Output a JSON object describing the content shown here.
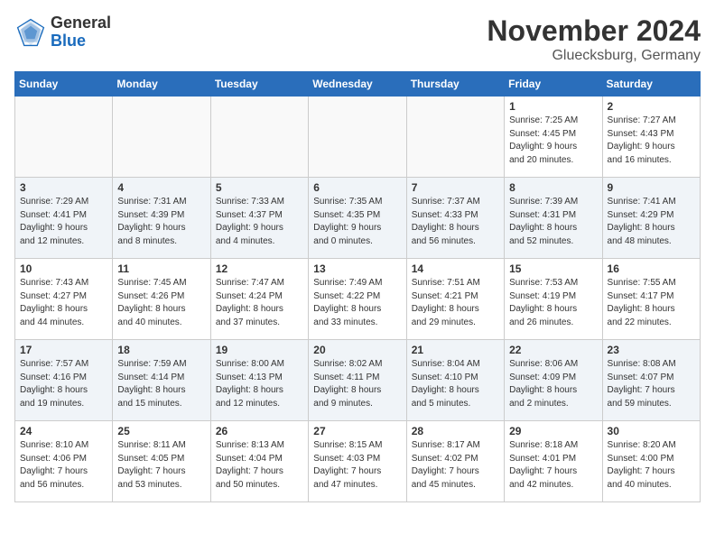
{
  "header": {
    "logo_general": "General",
    "logo_blue": "Blue",
    "month_title": "November 2024",
    "location": "Gluecksburg, Germany"
  },
  "weekdays": [
    "Sunday",
    "Monday",
    "Tuesday",
    "Wednesday",
    "Thursday",
    "Friday",
    "Saturday"
  ],
  "weeks": [
    [
      {
        "day": "",
        "info": ""
      },
      {
        "day": "",
        "info": ""
      },
      {
        "day": "",
        "info": ""
      },
      {
        "day": "",
        "info": ""
      },
      {
        "day": "",
        "info": ""
      },
      {
        "day": "1",
        "info": "Sunrise: 7:25 AM\nSunset: 4:45 PM\nDaylight: 9 hours\nand 20 minutes."
      },
      {
        "day": "2",
        "info": "Sunrise: 7:27 AM\nSunset: 4:43 PM\nDaylight: 9 hours\nand 16 minutes."
      }
    ],
    [
      {
        "day": "3",
        "info": "Sunrise: 7:29 AM\nSunset: 4:41 PM\nDaylight: 9 hours\nand 12 minutes."
      },
      {
        "day": "4",
        "info": "Sunrise: 7:31 AM\nSunset: 4:39 PM\nDaylight: 9 hours\nand 8 minutes."
      },
      {
        "day": "5",
        "info": "Sunrise: 7:33 AM\nSunset: 4:37 PM\nDaylight: 9 hours\nand 4 minutes."
      },
      {
        "day": "6",
        "info": "Sunrise: 7:35 AM\nSunset: 4:35 PM\nDaylight: 9 hours\nand 0 minutes."
      },
      {
        "day": "7",
        "info": "Sunrise: 7:37 AM\nSunset: 4:33 PM\nDaylight: 8 hours\nand 56 minutes."
      },
      {
        "day": "8",
        "info": "Sunrise: 7:39 AM\nSunset: 4:31 PM\nDaylight: 8 hours\nand 52 minutes."
      },
      {
        "day": "9",
        "info": "Sunrise: 7:41 AM\nSunset: 4:29 PM\nDaylight: 8 hours\nand 48 minutes."
      }
    ],
    [
      {
        "day": "10",
        "info": "Sunrise: 7:43 AM\nSunset: 4:27 PM\nDaylight: 8 hours\nand 44 minutes."
      },
      {
        "day": "11",
        "info": "Sunrise: 7:45 AM\nSunset: 4:26 PM\nDaylight: 8 hours\nand 40 minutes."
      },
      {
        "day": "12",
        "info": "Sunrise: 7:47 AM\nSunset: 4:24 PM\nDaylight: 8 hours\nand 37 minutes."
      },
      {
        "day": "13",
        "info": "Sunrise: 7:49 AM\nSunset: 4:22 PM\nDaylight: 8 hours\nand 33 minutes."
      },
      {
        "day": "14",
        "info": "Sunrise: 7:51 AM\nSunset: 4:21 PM\nDaylight: 8 hours\nand 29 minutes."
      },
      {
        "day": "15",
        "info": "Sunrise: 7:53 AM\nSunset: 4:19 PM\nDaylight: 8 hours\nand 26 minutes."
      },
      {
        "day": "16",
        "info": "Sunrise: 7:55 AM\nSunset: 4:17 PM\nDaylight: 8 hours\nand 22 minutes."
      }
    ],
    [
      {
        "day": "17",
        "info": "Sunrise: 7:57 AM\nSunset: 4:16 PM\nDaylight: 8 hours\nand 19 minutes."
      },
      {
        "day": "18",
        "info": "Sunrise: 7:59 AM\nSunset: 4:14 PM\nDaylight: 8 hours\nand 15 minutes."
      },
      {
        "day": "19",
        "info": "Sunrise: 8:00 AM\nSunset: 4:13 PM\nDaylight: 8 hours\nand 12 minutes."
      },
      {
        "day": "20",
        "info": "Sunrise: 8:02 AM\nSunset: 4:11 PM\nDaylight: 8 hours\nand 9 minutes."
      },
      {
        "day": "21",
        "info": "Sunrise: 8:04 AM\nSunset: 4:10 PM\nDaylight: 8 hours\nand 5 minutes."
      },
      {
        "day": "22",
        "info": "Sunrise: 8:06 AM\nSunset: 4:09 PM\nDaylight: 8 hours\nand 2 minutes."
      },
      {
        "day": "23",
        "info": "Sunrise: 8:08 AM\nSunset: 4:07 PM\nDaylight: 7 hours\nand 59 minutes."
      }
    ],
    [
      {
        "day": "24",
        "info": "Sunrise: 8:10 AM\nSunset: 4:06 PM\nDaylight: 7 hours\nand 56 minutes."
      },
      {
        "day": "25",
        "info": "Sunrise: 8:11 AM\nSunset: 4:05 PM\nDaylight: 7 hours\nand 53 minutes."
      },
      {
        "day": "26",
        "info": "Sunrise: 8:13 AM\nSunset: 4:04 PM\nDaylight: 7 hours\nand 50 minutes."
      },
      {
        "day": "27",
        "info": "Sunrise: 8:15 AM\nSunset: 4:03 PM\nDaylight: 7 hours\nand 47 minutes."
      },
      {
        "day": "28",
        "info": "Sunrise: 8:17 AM\nSunset: 4:02 PM\nDaylight: 7 hours\nand 45 minutes."
      },
      {
        "day": "29",
        "info": "Sunrise: 8:18 AM\nSunset: 4:01 PM\nDaylight: 7 hours\nand 42 minutes."
      },
      {
        "day": "30",
        "info": "Sunrise: 8:20 AM\nSunset: 4:00 PM\nDaylight: 7 hours\nand 40 minutes."
      }
    ]
  ]
}
